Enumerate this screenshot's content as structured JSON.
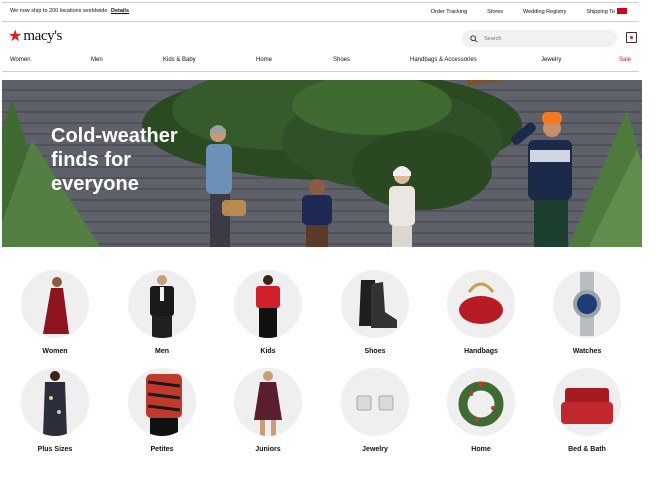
{
  "topbar": {
    "ship_message": "We now ship to 200 locations worldwide",
    "details_link": "Details",
    "links": [
      "Order Tracking",
      "Stores",
      "Wedding Registry",
      "Shipping To"
    ]
  },
  "header": {
    "logo": "macy's",
    "search_placeholder": "Search"
  },
  "nav": {
    "items": [
      "Women",
      "Men",
      "Kids & Baby",
      "Home",
      "Shoes",
      "Handbags & Accessories",
      "Jewelry",
      "Sale"
    ]
  },
  "hero": {
    "headline_line1": "Cold-weather",
    "headline_line2": "finds for",
    "headline_line3": "everyone"
  },
  "categories": [
    {
      "label": "Women",
      "icon": "red-dress-icon"
    },
    {
      "label": "Men",
      "icon": "black-suit-icon"
    },
    {
      "label": "Kids",
      "icon": "kids-sweater-icon"
    },
    {
      "label": "Shoes",
      "icon": "black-boot-icon"
    },
    {
      "label": "Handbags",
      "icon": "red-handbag-icon"
    },
    {
      "label": "Watches",
      "icon": "watch-icon"
    },
    {
      "label": "Plus Sizes",
      "icon": "floral-dress-icon"
    },
    {
      "label": "Petites",
      "icon": "zebra-top-icon"
    },
    {
      "label": "Juniors",
      "icon": "maroon-dress-icon"
    },
    {
      "label": "Jewelry",
      "icon": "diamond-earrings-icon"
    },
    {
      "label": "Home",
      "icon": "wreath-icon"
    },
    {
      "label": "Bed & Bath",
      "icon": "red-bedding-icon"
    }
  ],
  "colors": {
    "brand_red": "#e11b22",
    "hero_wall": "#5f616a",
    "hero_text": "#ffffff"
  }
}
